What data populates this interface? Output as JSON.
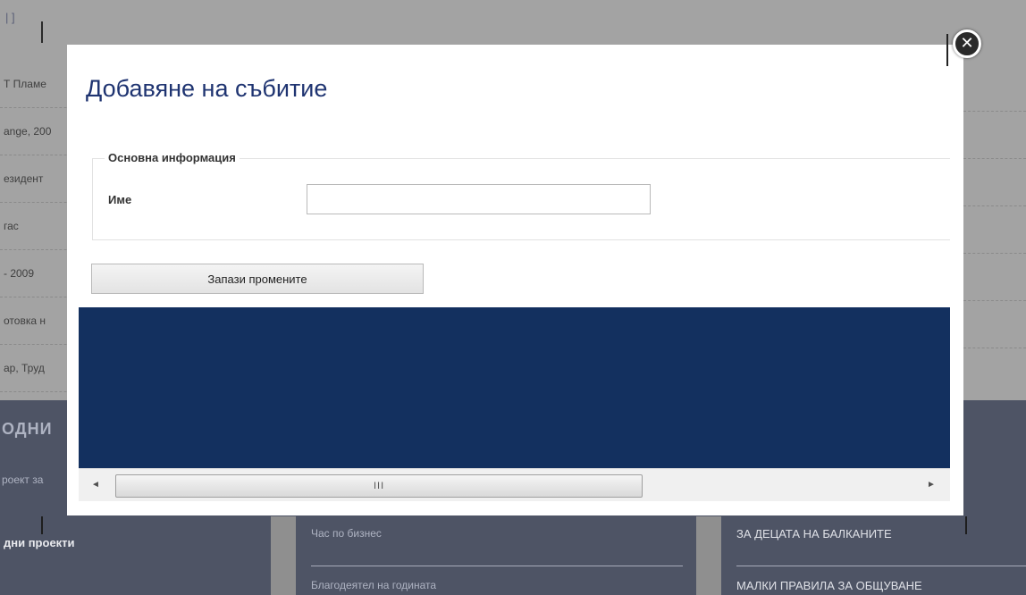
{
  "background": {
    "top_link": "| ]",
    "list_items": [
      "Т Пламе",
      "ange, 200",
      "езидент",
      "гас",
      "- 2009",
      "отовка н",
      "ар, Труд"
    ],
    "section_heading": "ОДНИ",
    "section_sub": "роект за",
    "columns": {
      "left_title": "дни проекти",
      "middle_links": [
        "Час по бизнес",
        "Благодеятел на годината"
      ],
      "right_links": [
        "ЗА ДЕЦАТА НА БАЛКАНИТЕ",
        "МАЛКИ ПРАВИЛА ЗА ОБЩУВАНЕ"
      ]
    }
  },
  "modal": {
    "title": "Добавяне на събитие",
    "fieldset_legend": "Основна информация",
    "name_label": "Име",
    "name_value": "",
    "save_label": "Запази промените",
    "iframe_color": "#13305f",
    "scrollbar": {
      "left_arrow": "◄",
      "right_arrow": "►",
      "grip": "III"
    },
    "close_label": "✕"
  }
}
